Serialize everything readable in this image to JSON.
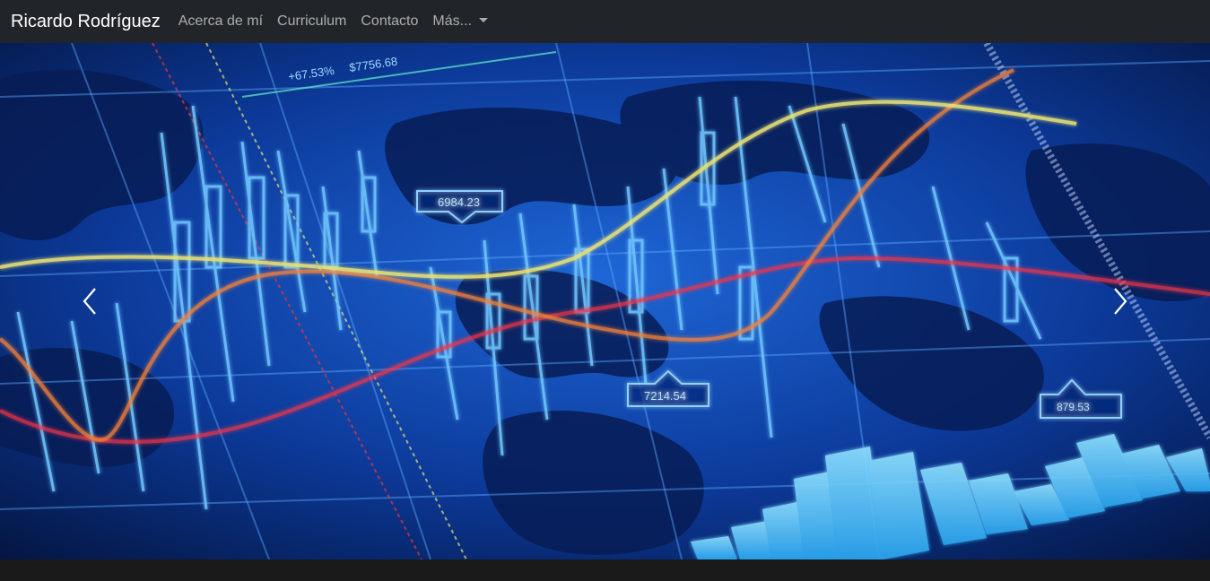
{
  "navbar": {
    "brand": "Ricardo Rodríguez",
    "links": [
      {
        "label": "Acerca de mí"
      },
      {
        "label": "Curriculum"
      },
      {
        "label": "Contacto"
      }
    ],
    "dropdown_label": "Más..."
  },
  "carousel": {
    "labels": {
      "percent": "+67.53%",
      "price": "$7756.68",
      "callout_1": "6984.23",
      "callout_2": "7214.54",
      "callout_3": "879.53"
    },
    "prev_icon": "chevron-left-icon",
    "next_icon": "chevron-right-icon"
  },
  "colors": {
    "navbar_bg": "#212529",
    "slide_bg_dark": "#041540",
    "slide_bg_light": "#1e66d6",
    "accent_yellow": "#e8e276",
    "accent_red": "#f0364a",
    "accent_orange": "#f4823a"
  }
}
